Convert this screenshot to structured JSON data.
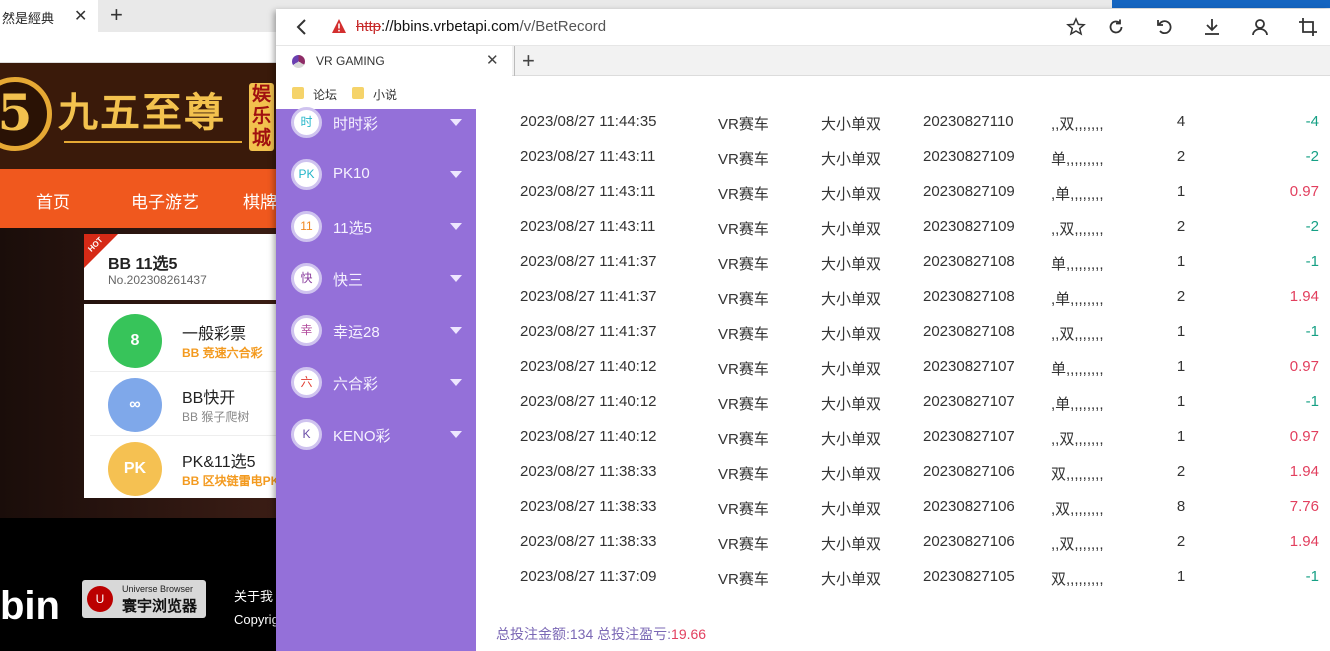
{
  "background_window": {
    "tab_title": "然是經典",
    "tab_close": "✕",
    "newtab": "+",
    "site": {
      "logo_mark": "5",
      "logo_text": "九五至尊",
      "badge": "娱乐城",
      "nav": [
        "首页",
        "电子游艺",
        "棋牌"
      ],
      "hot_flag": "HOT",
      "hot_title": "BB 11选5",
      "hot_number": "No.202308261437",
      "games": [
        {
          "name": "一般彩票",
          "sub": "BB 竞速六合彩",
          "icon": "8",
          "color": "#37c45a",
          "subcolor": "#f39a1f"
        },
        {
          "name": "BB快开",
          "sub": "BB 猴子爬树",
          "icon": "∞",
          "color": "#7fa8ea",
          "subcolor": "#888888"
        },
        {
          "name": "PK&11选5",
          "sub": "BB 区块链雷电PK",
          "icon": "PK",
          "color": "#f5c152",
          "subcolor": "#f39a1f"
        }
      ],
      "footer_logo": "bin",
      "ub_icon": "U",
      "ub_line1": "Universe Browser",
      "ub_line2": "寰宇浏览器",
      "footer_links": [
        "关于我",
        "Copyrig"
      ]
    }
  },
  "popup": {
    "url": {
      "scheme": "http",
      "host": "://bbins.vrbetapi.com",
      "path": "/v/BetRecord"
    },
    "tab": {
      "title": "VR GAMING",
      "close": "✕",
      "newtab": "+"
    },
    "bookmarks": [
      "论坛",
      "小说"
    ],
    "sidebar": [
      {
        "label": "时时彩",
        "glyph": "时",
        "color": "#23b5c9"
      },
      {
        "label": "PK10",
        "glyph": "PK",
        "color": "#23b5c9"
      },
      {
        "label": "11选5",
        "glyph": "11",
        "color": "#f08a24"
      },
      {
        "label": "快三",
        "glyph": "快",
        "color": "#8a3e9e"
      },
      {
        "label": "幸运28",
        "glyph": "幸",
        "color": "#b24a9c"
      },
      {
        "label": "六合彩",
        "glyph": "六",
        "color": "#e03a2e"
      },
      {
        "label": "KENO彩",
        "glyph": "K",
        "color": "#6a4ea8"
      }
    ],
    "records": [
      {
        "time": "2023/08/27 11:44:35",
        "game": "VR赛车",
        "play": "大小单双",
        "issue": "20230827110",
        "bet": ",,双,,,,,,,",
        "amount": "4",
        "win": "-4"
      },
      {
        "time": "2023/08/27 11:43:11",
        "game": "VR赛车",
        "play": "大小单双",
        "issue": "20230827109",
        "bet": "单,,,,,,,,,",
        "amount": "2",
        "win": "-2"
      },
      {
        "time": "2023/08/27 11:43:11",
        "game": "VR赛车",
        "play": "大小单双",
        "issue": "20230827109",
        "bet": ",单,,,,,,,,",
        "amount": "1",
        "win": "0.97"
      },
      {
        "time": "2023/08/27 11:43:11",
        "game": "VR赛车",
        "play": "大小单双",
        "issue": "20230827109",
        "bet": ",,双,,,,,,,",
        "amount": "2",
        "win": "-2"
      },
      {
        "time": "2023/08/27 11:41:37",
        "game": "VR赛车",
        "play": "大小单双",
        "issue": "20230827108",
        "bet": "单,,,,,,,,,",
        "amount": "1",
        "win": "-1"
      },
      {
        "time": "2023/08/27 11:41:37",
        "game": "VR赛车",
        "play": "大小单双",
        "issue": "20230827108",
        "bet": ",单,,,,,,,,",
        "amount": "2",
        "win": "1.94"
      },
      {
        "time": "2023/08/27 11:41:37",
        "game": "VR赛车",
        "play": "大小单双",
        "issue": "20230827108",
        "bet": ",,双,,,,,,,",
        "amount": "1",
        "win": "-1"
      },
      {
        "time": "2023/08/27 11:40:12",
        "game": "VR赛车",
        "play": "大小单双",
        "issue": "20230827107",
        "bet": "单,,,,,,,,,",
        "amount": "1",
        "win": "0.97"
      },
      {
        "time": "2023/08/27 11:40:12",
        "game": "VR赛车",
        "play": "大小单双",
        "issue": "20230827107",
        "bet": ",单,,,,,,,,",
        "amount": "1",
        "win": "-1"
      },
      {
        "time": "2023/08/27 11:40:12",
        "game": "VR赛车",
        "play": "大小单双",
        "issue": "20230827107",
        "bet": ",,双,,,,,,,",
        "amount": "1",
        "win": "0.97"
      },
      {
        "time": "2023/08/27 11:38:33",
        "game": "VR赛车",
        "play": "大小单双",
        "issue": "20230827106",
        "bet": "双,,,,,,,,,",
        "amount": "2",
        "win": "1.94"
      },
      {
        "time": "2023/08/27 11:38:33",
        "game": "VR赛车",
        "play": "大小单双",
        "issue": "20230827106",
        "bet": ",双,,,,,,,,",
        "amount": "8",
        "win": "7.76"
      },
      {
        "time": "2023/08/27 11:38:33",
        "game": "VR赛车",
        "play": "大小单双",
        "issue": "20230827106",
        "bet": ",,双,,,,,,,",
        "amount": "2",
        "win": "1.94"
      },
      {
        "time": "2023/08/27 11:37:09",
        "game": "VR赛车",
        "play": "大小单双",
        "issue": "20230827105",
        "bet": "双,,,,,,,,,",
        "amount": "1",
        "win": "-1"
      }
    ],
    "summary": {
      "label": "总投注金额:134 总投注盈亏:",
      "value": "19.66"
    }
  }
}
